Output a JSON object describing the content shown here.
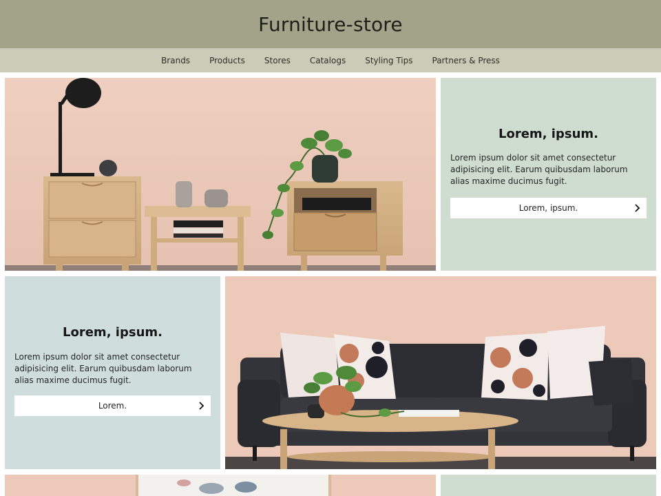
{
  "site": {
    "title": "Furniture-store"
  },
  "nav": {
    "items": [
      "Brands",
      "Products",
      "Stores",
      "Catalogs",
      "Styling Tips",
      "Partners & Press"
    ]
  },
  "cards": [
    {
      "heading": "Lorem, ipsum.",
      "body": "Lorem ipsum dolor sit amet consectetur adipisicing elit. Earum quibusdam laborum alias maxime ducimus fugit.",
      "button_label": "Lorem, ipsum.",
      "bg": "#cfdcd0"
    },
    {
      "heading": "Lorem, ipsum.",
      "body": "Lorem ipsum dolor sit amet consectetur adipisicing elit. Earum quibusdam laborum alias maxime ducimus fugit.",
      "button_label": "Lorem.",
      "bg": "#cfdedc"
    }
  ],
  "colors": {
    "header_bg": "#a3a38a",
    "nav_bg": "#cbcbb8",
    "wall_pink": "#eccbbb"
  },
  "icons": [
    "chevron-right-icon",
    "chevron-right-icon"
  ]
}
